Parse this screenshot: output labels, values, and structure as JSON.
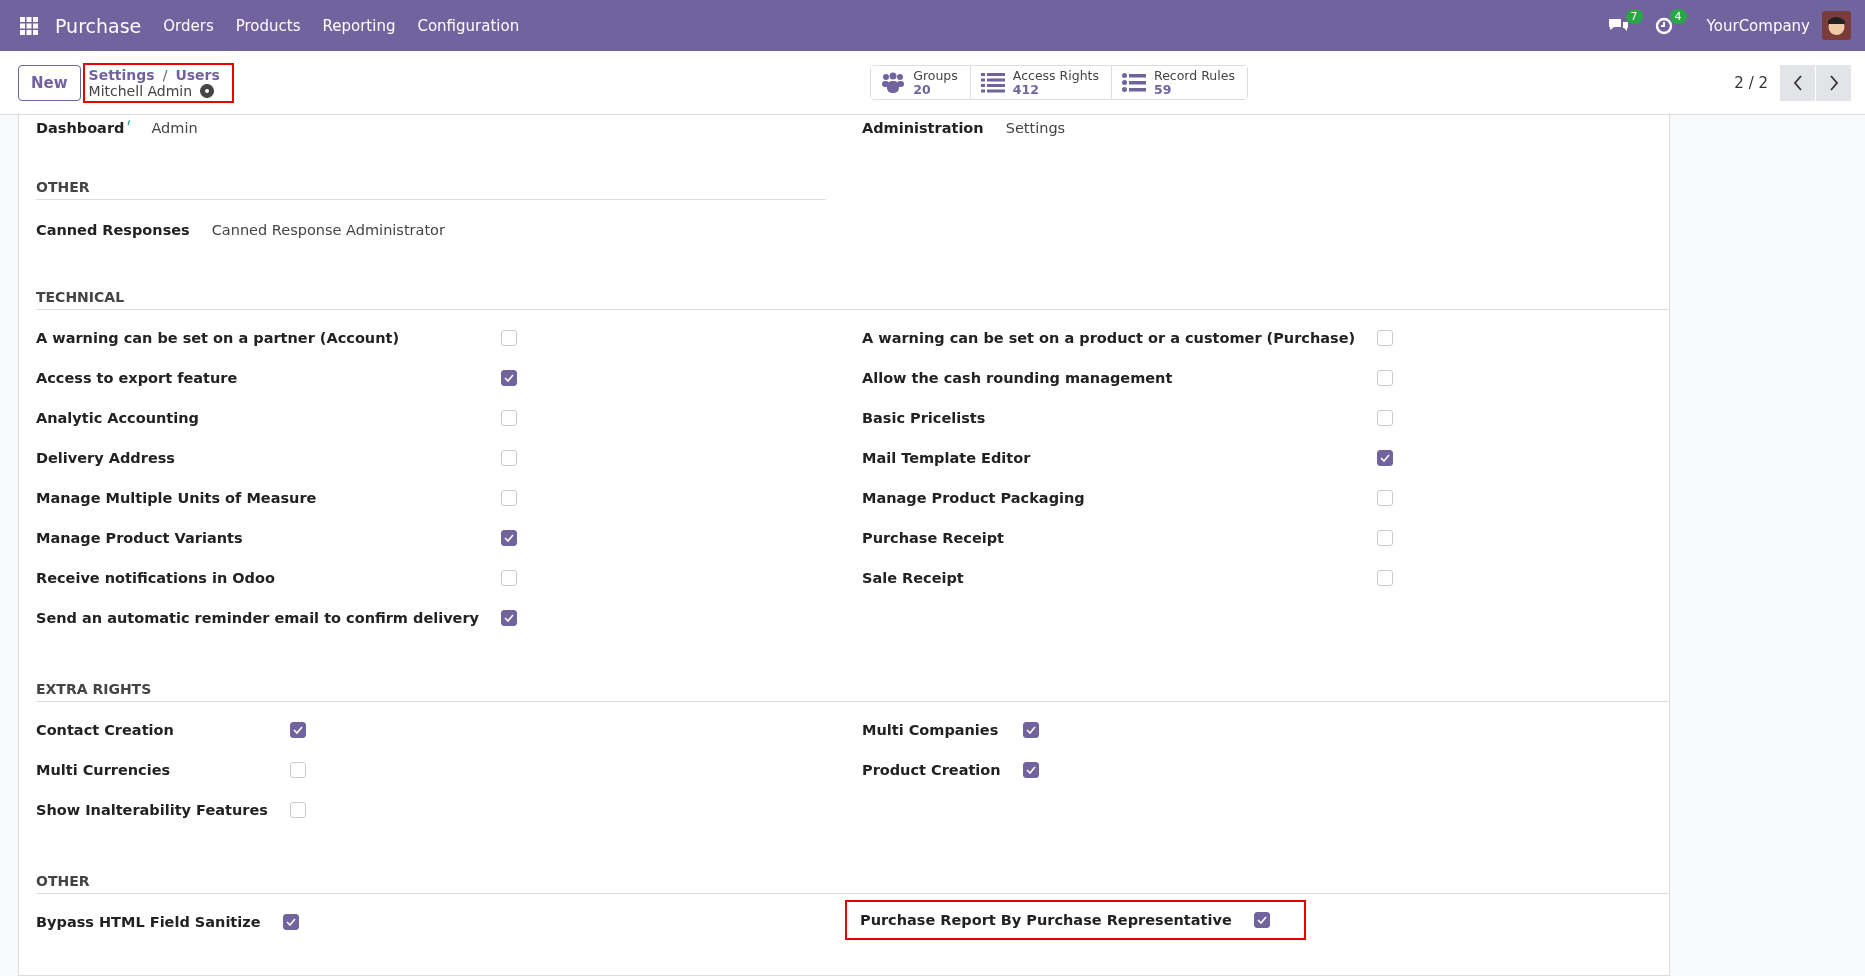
{
  "navbar": {
    "app": "Purchase",
    "menu": [
      "Orders",
      "Products",
      "Reporting",
      "Configuration"
    ],
    "messages_count": "7",
    "activities_count": "4",
    "company": "YourCompany"
  },
  "control_panel": {
    "new_button": "New",
    "breadcrumb": [
      "Settings",
      "Users"
    ],
    "separator": "/",
    "record": "Mitchell Admin",
    "highlighted": true,
    "stat_buttons": [
      {
        "kind": "groups",
        "label": "Groups",
        "value": "20"
      },
      {
        "kind": "list",
        "label": "Access Rights",
        "value": "412"
      },
      {
        "kind": "bullets",
        "label": "Record Rules",
        "value": "59"
      }
    ],
    "pager": "2 / 2"
  },
  "top_fields": [
    {
      "label": "Dashboard",
      "value": "Admin",
      "help": true
    },
    {
      "label": "Administration",
      "value": "Settings",
      "help": false
    }
  ],
  "sections": [
    {
      "title": "OTHER",
      "full_width": false,
      "columns": [
        [
          {
            "kind": "select",
            "label": "Canned Responses",
            "value": "Canned Response Administrator"
          }
        ],
        []
      ]
    },
    {
      "title": "TECHNICAL",
      "full_width": true,
      "columns": [
        [
          {
            "kind": "check",
            "label": "A warning can be set on a partner (Account)",
            "checked": false
          },
          {
            "kind": "check",
            "label": "Access to export feature",
            "checked": true
          },
          {
            "kind": "check",
            "label": "Analytic Accounting",
            "checked": false
          },
          {
            "kind": "check",
            "label": "Delivery Address",
            "checked": false
          },
          {
            "kind": "check",
            "label": "Manage Multiple Units of Measure",
            "checked": false
          },
          {
            "kind": "check",
            "label": "Manage Product Variants",
            "checked": true
          },
          {
            "kind": "check",
            "label": "Receive notifications in Odoo",
            "checked": false
          },
          {
            "kind": "check",
            "label": "Send an automatic reminder email to confirm delivery",
            "checked": true
          }
        ],
        [
          {
            "kind": "check",
            "label": "A warning can be set on a product or a customer (Purchase)",
            "checked": false
          },
          {
            "kind": "check",
            "label": "Allow the cash rounding management",
            "checked": false
          },
          {
            "kind": "check",
            "label": "Basic Pricelists",
            "checked": false
          },
          {
            "kind": "check",
            "label": "Mail Template Editor",
            "checked": true
          },
          {
            "kind": "check",
            "label": "Manage Product Packaging",
            "checked": false
          },
          {
            "kind": "check",
            "label": "Purchase Receipt",
            "checked": false
          },
          {
            "kind": "check",
            "label": "Sale Receipt",
            "checked": false
          }
        ]
      ]
    },
    {
      "title": "EXTRA RIGHTS",
      "full_width": true,
      "columns": [
        [
          {
            "kind": "check",
            "label": "Contact Creation",
            "checked": true
          },
          {
            "kind": "check",
            "label": "Multi Currencies",
            "checked": false
          },
          {
            "kind": "check",
            "label": "Show Inalterability Features",
            "checked": false
          }
        ],
        [
          {
            "kind": "check",
            "label": "Multi Companies",
            "checked": true
          },
          {
            "kind": "check",
            "label": "Product Creation",
            "checked": true
          }
        ]
      ]
    },
    {
      "title": "OTHER",
      "full_width": true,
      "columns": [
        [
          {
            "kind": "check",
            "label": "Bypass HTML Field Sanitize",
            "checked": true
          }
        ],
        [
          {
            "kind": "check",
            "label": "Purchase Report By Purchase Representative",
            "checked": true,
            "highlighted": true
          }
        ]
      ]
    }
  ]
}
